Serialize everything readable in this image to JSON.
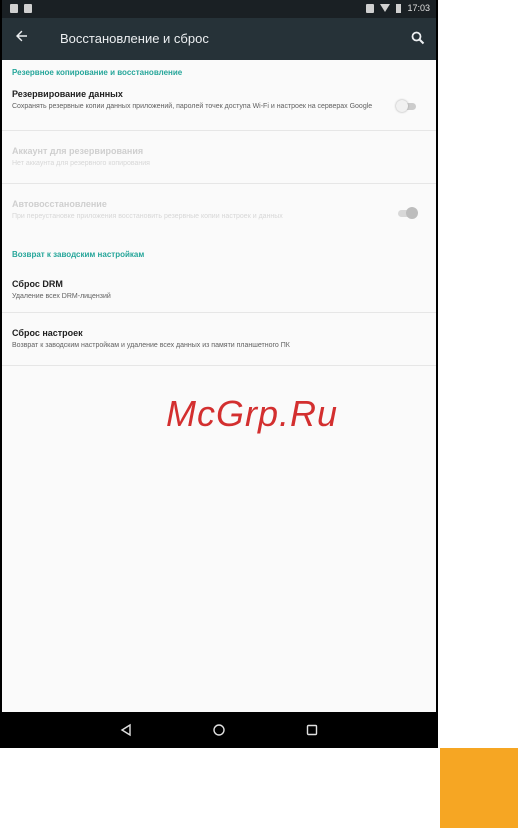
{
  "status_bar": {
    "time": "17:03"
  },
  "toolbar": {
    "title": "Восстановление и сброс"
  },
  "sections": [
    {
      "header": "Резервное копирование и восстановление",
      "items": [
        {
          "title": "Резервирование данных",
          "summary": "Сохранять резервные копии данных приложений, паролей точек доступа Wi-Fi и настроек на серверах Google",
          "switch": "off",
          "disabled": false
        },
        {
          "title": "Аккаунт для резервирования",
          "summary": "Нет аккаунта для резервного копирования",
          "disabled": true
        },
        {
          "title": "Автовосстановление",
          "summary": "При переустановке приложения восстановить резервные копии настроек и данных",
          "switch": "on",
          "disabled": true
        }
      ]
    },
    {
      "header": "Возврат к заводским настройкам",
      "items": [
        {
          "title": "Сброс DRM",
          "summary": "Удаление всех DRM-лицензий",
          "disabled": false
        },
        {
          "title": "Сброс настроек",
          "summary": "Возврат к заводским настройкам и удаление всех данных из памяти планшетного ПК",
          "disabled": false
        }
      ]
    }
  ],
  "watermark": "McGrp.Ru",
  "colors": {
    "toolbar": "#263238",
    "status_bar": "#1a2024",
    "accent": "#26a69a",
    "orange": "#f6a623"
  }
}
